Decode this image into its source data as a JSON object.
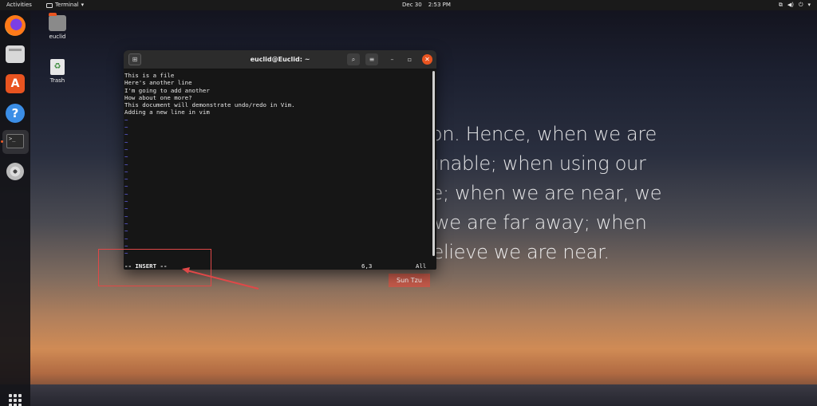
{
  "topbar": {
    "activities": "Activities",
    "app_name": "Terminal",
    "date": "Dec 30",
    "time": "2:53 PM"
  },
  "dock": {
    "apps": [
      "firefox-icon",
      "files-icon",
      "software-icon",
      "help-icon",
      "terminal-icon",
      "disc-icon"
    ],
    "terminal_glyph": ">_",
    "software_glyph": "A",
    "help_glyph": "?"
  },
  "desktop_icons": {
    "home_label": "euclid",
    "trash_label": "Trash"
  },
  "wallpaper_quote": {
    "lines": [
      "All warfare is based on deception. Hence, when we are",
      "able to attack, we must seem unable; when using our",
      "forces, we must appear inactive; when we are near, we",
      "must make the enemy believe we are far away; when",
      "far away, we must make him believe we are near."
    ],
    "author": "Sun Tzu"
  },
  "terminal": {
    "title": "euclid@Euclid: ~",
    "lines": [
      "This is a file",
      "Here's another line",
      "I'm going to add another",
      "How about one more?",
      "This document will demonstrate undo/redo in Vim.",
      "Adding a new line in vim"
    ],
    "tilde": "~",
    "status_mode": "-- INSERT --",
    "cursor_pos": "6,3",
    "scroll_pct": "All"
  },
  "colors": {
    "accent": "#e95420",
    "annotation": "#e04848",
    "tilde": "#6a6aff"
  }
}
